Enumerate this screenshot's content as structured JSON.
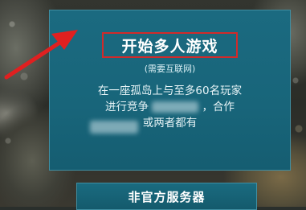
{
  "menu": {
    "start_multiplayer": {
      "title": "开始多人游戏",
      "subtitle": "(需要互联网)",
      "desc_line1": "在一座孤岛上与至多60名玩家",
      "desc_line2_a": "进行竞争",
      "desc_line2_b": "，合作",
      "desc_line3": "或两者都有"
    },
    "unofficial_servers_label": "非官方服务器"
  },
  "colors": {
    "card": "#1b6a80",
    "highlight_box": "#d22a2a",
    "arrow": "#e02020"
  },
  "icons": {
    "pointer": "red-arrow-icon"
  }
}
